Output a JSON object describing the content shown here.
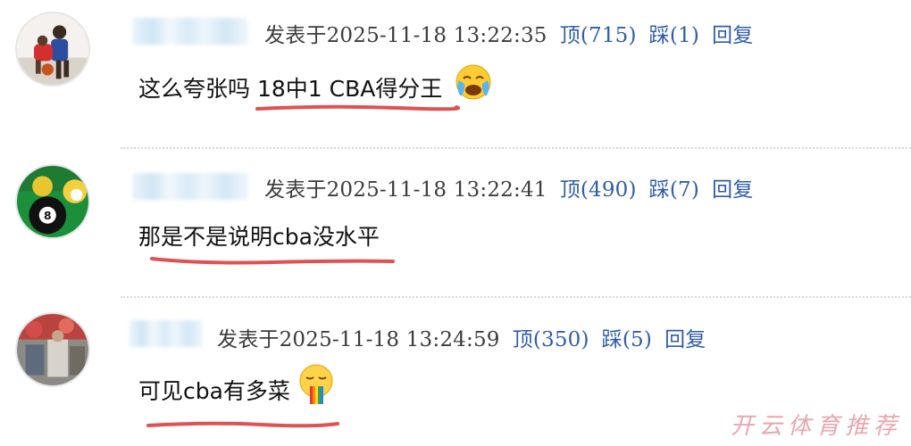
{
  "comments": [
    {
      "meta_prefix": "发表于2025-11-18 13:22:35",
      "top_label": "顶(715)",
      "down_label": "踩(1)",
      "reply_label": "回复",
      "text": "这么夸张吗 18中1 CBA得分王",
      "emoji": "crying-face-icon"
    },
    {
      "meta_prefix": "发表于2025-11-18 13:22:41",
      "top_label": "顶(490)",
      "down_label": "踩(7)",
      "reply_label": "回复",
      "text": "那是不是说明cba没水平",
      "emoji": ""
    },
    {
      "meta_prefix": "发表于2025-11-18 13:24:59",
      "top_label": "顶(350)",
      "down_label": "踩(5)",
      "reply_label": "回复",
      "text": "可见cba有多菜",
      "emoji": "vomiting-rainbow-face-icon"
    }
  ],
  "colors": {
    "link": "#2f5da8",
    "underline": "#e05252"
  },
  "watermark": "开云体育推荐"
}
